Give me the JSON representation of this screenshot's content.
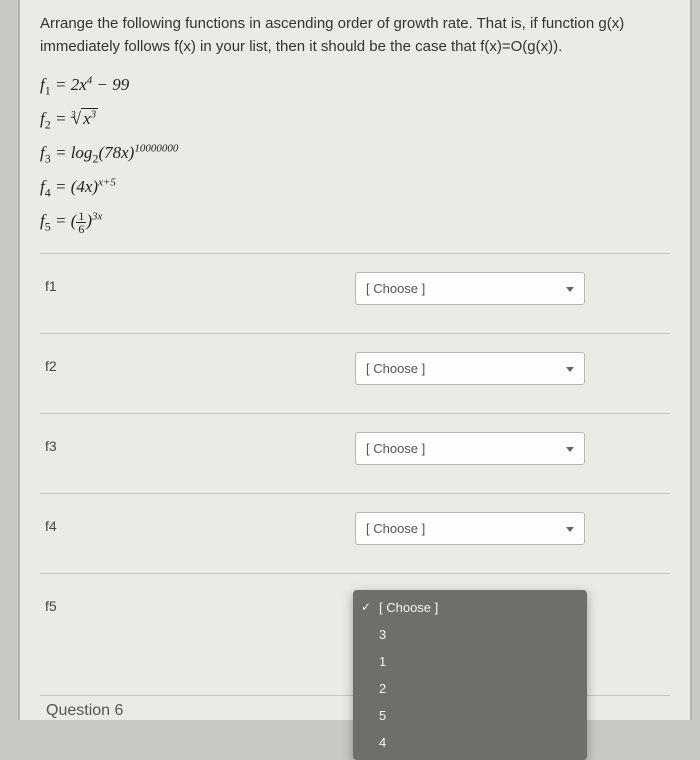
{
  "instructions": "Arrange the following functions in ascending order of growth rate. That is, if function g(x) immediately follows f(x) in your list, then it should be the case that f(x)=O(g(x)).",
  "formulas": {
    "f1_label": "f",
    "f1_sub": "1",
    "f1_eq": " = 2x",
    "f1_exp": "4",
    "f1_tail": " − 99",
    "f2_label": "f",
    "f2_sub": "2",
    "f2_eq": " = ",
    "f2_root": "3",
    "f2_radicand_base": "x",
    "f2_radicand_exp": "3",
    "f3_label": "f",
    "f3_sub": "3",
    "f3_eq": " = log",
    "f3_logbase": "2",
    "f3_arg": "(78x)",
    "f3_exp": "10000000",
    "f4_label": "f",
    "f4_sub": "4",
    "f4_eq": " = (4x)",
    "f4_exp": "x+5",
    "f5_label": "f",
    "f5_sub": "5",
    "f5_eq": " = (",
    "f5_frac_num": "1",
    "f5_frac_den": "6",
    "f5_close": ")",
    "f5_exp": "3x"
  },
  "rows": {
    "r1": "f1",
    "r2": "f2",
    "r3": "f3",
    "r4": "f4",
    "r5": "f5"
  },
  "choose_placeholder": "[ Choose ]",
  "dropdown": {
    "selected": "[ Choose ]",
    "opt1": "3",
    "opt2": "1",
    "opt3": "2",
    "opt4": "5",
    "opt5": "4"
  },
  "footer": "Question 6"
}
